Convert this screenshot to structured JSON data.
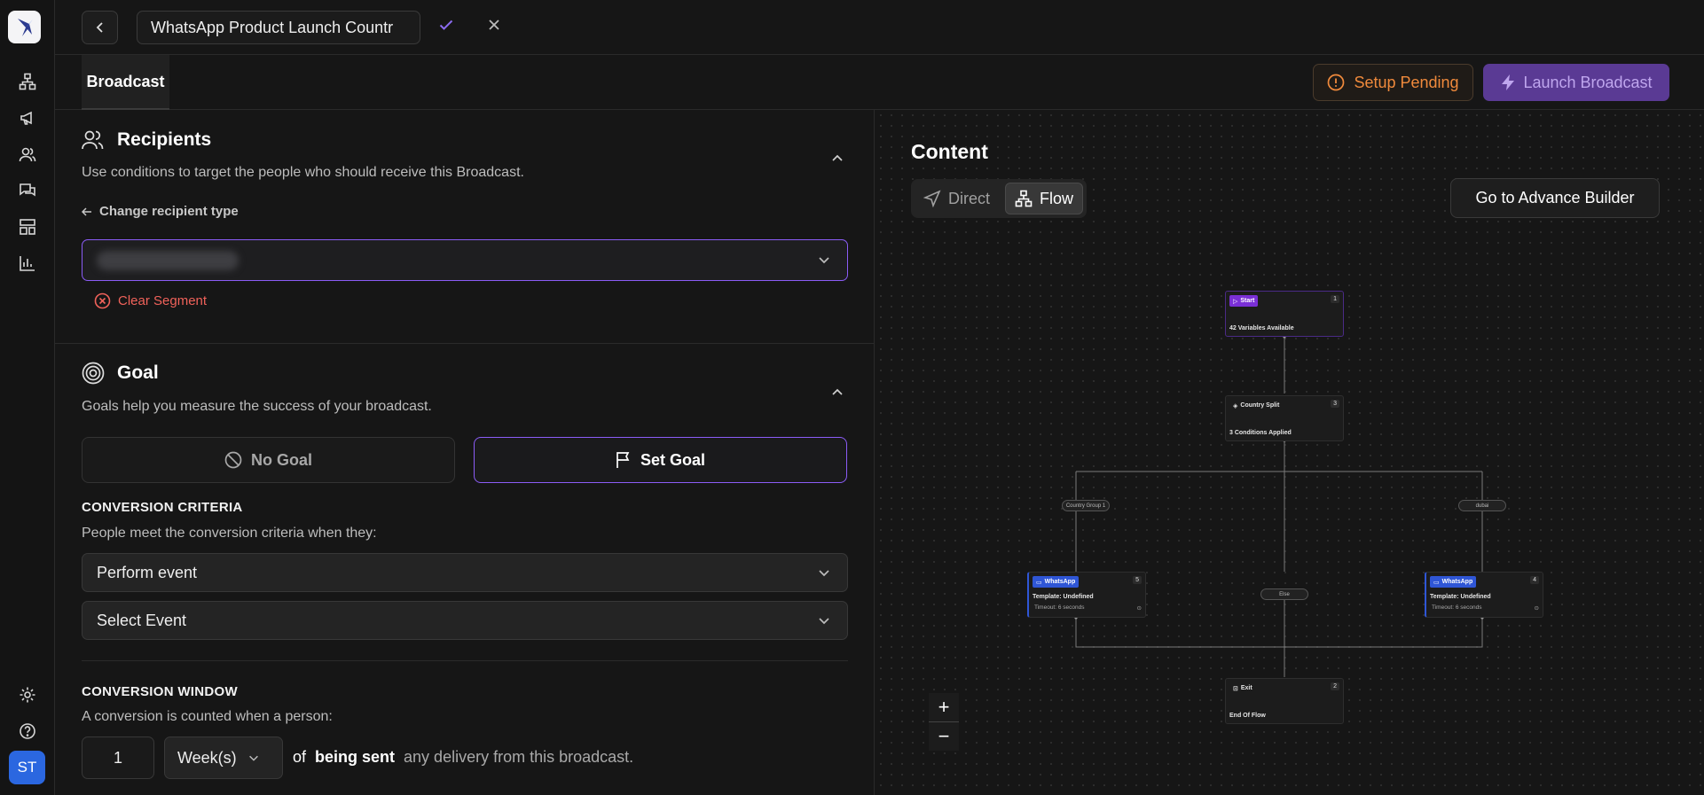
{
  "app": {
    "avatar_initials": "ST",
    "brand_color": "#8b5cf6"
  },
  "rail": {
    "icons": [
      "flow-icon",
      "megaphone-icon",
      "users-icon",
      "chat-icon",
      "layout-icon",
      "chart-icon",
      "gear-icon",
      "help-icon"
    ]
  },
  "header": {
    "broadcast_name": "WhatsApp Product Launch Countr"
  },
  "tabs": {
    "broadcast": "Broadcast"
  },
  "actions": {
    "setup_pending": "Setup Pending",
    "launch": "Launch Broadcast"
  },
  "recipients": {
    "title": "Recipients",
    "description": "Use conditions to target the people who should receive this Broadcast.",
    "change_type": "Change recipient type",
    "clear_segment": "Clear Segment"
  },
  "goal": {
    "title": "Goal",
    "description": "Goals help you measure the success of your broadcast.",
    "no_goal": "No Goal",
    "set_goal": "Set Goal",
    "criteria_title": "CONVERSION CRITERIA",
    "criteria_desc": "People meet the conversion criteria when they:",
    "perform_event": "Perform event",
    "select_event": "Select Event",
    "window_title": "CONVERSION WINDOW",
    "window_desc": "A conversion is counted when a person:",
    "window_value": "1",
    "window_unit": "Week(s)",
    "of": "of",
    "being_sent": "being sent",
    "tail": "any delivery from this broadcast."
  },
  "content": {
    "title": "Content",
    "mode_direct": "Direct",
    "mode_flow": "Flow",
    "advance_builder": "Go to Advance Builder"
  },
  "flow": {
    "start": {
      "label": "Start",
      "num": "1",
      "sub": "42 Variables Available"
    },
    "split": {
      "label": "Country Split",
      "num": "3",
      "sub": "3 Conditions Applied"
    },
    "wa_left": {
      "label": "WhatsApp",
      "num": "5",
      "sub": "Template: Undefined",
      "timeout": "Timeout: 6 seconds"
    },
    "wa_right": {
      "label": "WhatsApp",
      "num": "4",
      "sub": "Template: Undefined",
      "timeout": "Timeout: 6 seconds"
    },
    "exit": {
      "label": "Exit",
      "num": "2",
      "sub": "End Of Flow"
    },
    "branch_left": "Country Group 1",
    "branch_mid": "Else",
    "branch_right": "dubai"
  },
  "zoom": {
    "in": "+",
    "out": "−"
  }
}
